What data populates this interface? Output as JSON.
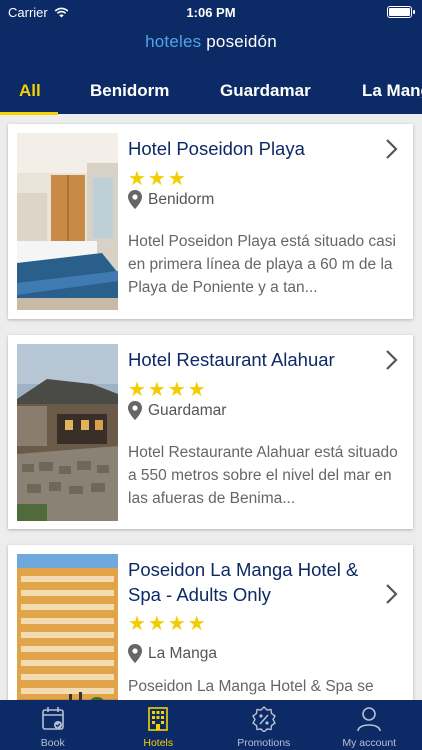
{
  "status": {
    "carrier": "Carrier",
    "time": "1:06 PM"
  },
  "logo": {
    "part1": "hoteles",
    "part2": "poseidón"
  },
  "tabs": [
    {
      "label": "All"
    },
    {
      "label": "Benidorm"
    },
    {
      "label": "Guardamar"
    },
    {
      "label": "La Manga"
    }
  ],
  "hotels": [
    {
      "title": "Hotel Poseidon Playa",
      "stars": "★★★",
      "location": "Benidorm",
      "description": "Hotel Poseidon Playa está situado casi en primera línea de playa a 60 m de la Playa de Poniente y a tan..."
    },
    {
      "title": "Hotel Restaurant Alahuar",
      "stars": "★★★★",
      "location": "Guardamar",
      "description": "Hotel Restaurante Alahuar está situado a 550 metros sobre el nivel del mar en las afueras de Benima..."
    },
    {
      "title": "Poseidon La Manga Hotel & Spa - Adults Only",
      "stars": "★★★★",
      "location": "La Manga",
      "description": "Poseidon La Manga Hotel & Spa se encuentra en una zona privilegiada"
    }
  ],
  "tabbar": [
    {
      "label": "Book",
      "icon": "calendar-icon"
    },
    {
      "label": "Hotels",
      "icon": "building-icon"
    },
    {
      "label": "Promotions",
      "icon": "percent-badge-icon"
    },
    {
      "label": "My account",
      "icon": "person-icon"
    }
  ],
  "colors": {
    "navy": "#0c2a66",
    "accent": "#f5d200",
    "star": "#f2cd00",
    "logo_light": "#4fa5e6"
  }
}
